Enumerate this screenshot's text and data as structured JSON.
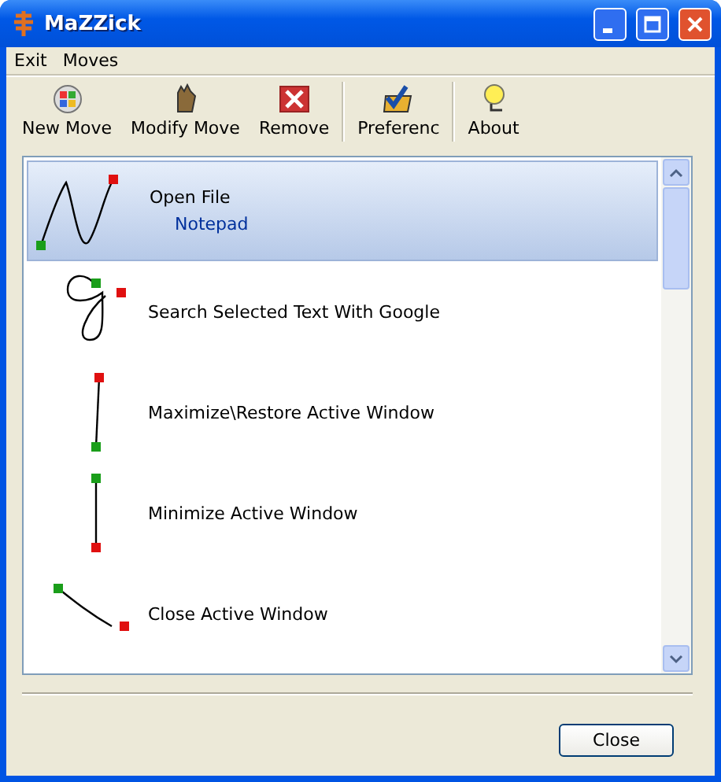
{
  "window": {
    "title": "MaZZick"
  },
  "menu": [
    "Exit",
    "Moves"
  ],
  "toolbar": [
    {
      "label": "New Move",
      "kind": "new"
    },
    {
      "label": "Modify Move",
      "kind": "modify"
    },
    {
      "label": "Remove",
      "kind": "remove"
    },
    {
      "label": "Preferenc",
      "kind": "prefs"
    },
    {
      "label": "About",
      "kind": "about"
    }
  ],
  "moves": [
    {
      "name": "Open File",
      "detail": "Notepad",
      "kind": "n",
      "selected": true
    },
    {
      "name": "Search Selected Text With Google",
      "kind": "g",
      "selected": false
    },
    {
      "name": "Maximize\\Restore Active Window",
      "kind": "up",
      "selected": false
    },
    {
      "name": "Minimize Active Window",
      "kind": "down",
      "selected": false
    },
    {
      "name": "Close Active Window",
      "kind": "diagonal",
      "selected": false
    }
  ],
  "buttons": [
    "Close"
  ]
}
